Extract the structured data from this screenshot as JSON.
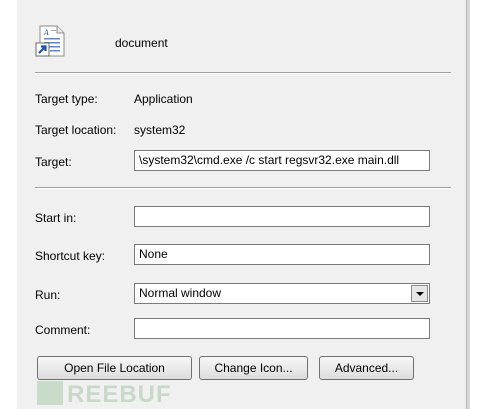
{
  "header": {
    "name": "document"
  },
  "info": {
    "target_type_label": "Target type:",
    "target_type_value": "Application",
    "target_location_label": "Target location:",
    "target_location_value": "system32"
  },
  "fields": {
    "target_label": "Target:",
    "target_value": "\\system32\\cmd.exe /c start regsvr32.exe main.dll",
    "start_in_label": "Start in:",
    "start_in_value": "",
    "shortcut_key_label": "Shortcut key:",
    "shortcut_key_value": "None",
    "run_label": "Run:",
    "run_value": "Normal window",
    "comment_label": "Comment:",
    "comment_value": ""
  },
  "buttons": {
    "open_file_location": "Open File Location",
    "change_icon": "Change Icon...",
    "advanced": "Advanced..."
  },
  "watermark": {
    "text": "REEBUF"
  },
  "icons": {
    "shortcut_icon": "document-shortcut-icon",
    "dropdown_icon": "chevron-down-icon"
  }
}
